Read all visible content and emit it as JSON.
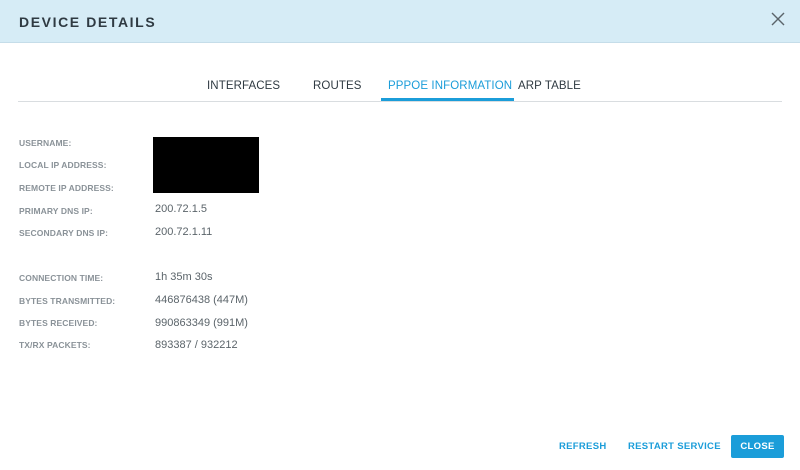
{
  "dialog": {
    "title": "DEVICE DETAILS"
  },
  "tabs": [
    {
      "label": "INTERFACES",
      "active": false
    },
    {
      "label": "ROUTES",
      "active": false
    },
    {
      "label": "PPPOE INFORMATION",
      "active": true
    },
    {
      "label": "ARP TABLE",
      "active": false
    }
  ],
  "info": {
    "username_label": "USERNAME:",
    "local_ip_label": "LOCAL IP ADDRESS:",
    "remote_ip_label": "REMOTE IP ADDRESS:",
    "primary_dns_label": "PRIMARY DNS IP:",
    "primary_dns_value": "200.72.1.5",
    "secondary_dns_label": "SECONDARY DNS IP:",
    "secondary_dns_value": "200.72.1.11",
    "connection_time_label": "CONNECTION TIME:",
    "connection_time_value": "1h 35m 30s",
    "bytes_tx_label": "BYTES TRANSMITTED:",
    "bytes_tx_value": "446876438 (447M)",
    "bytes_rx_label": "BYTES RECEIVED:",
    "bytes_rx_value": "990863349 (991M)",
    "packets_label": "TX/RX PACKETS:",
    "packets_value": "893387 / 932212"
  },
  "footer": {
    "refresh_label": "REFRESH",
    "restart_label": "RESTART SERVICE",
    "close_label": "CLOSE"
  },
  "colors": {
    "header_bg": "#d6ecf6",
    "accent": "#1b9dd9",
    "label": "#8a9298",
    "value": "#5b646a"
  },
  "icons": {
    "close": "close-icon"
  }
}
